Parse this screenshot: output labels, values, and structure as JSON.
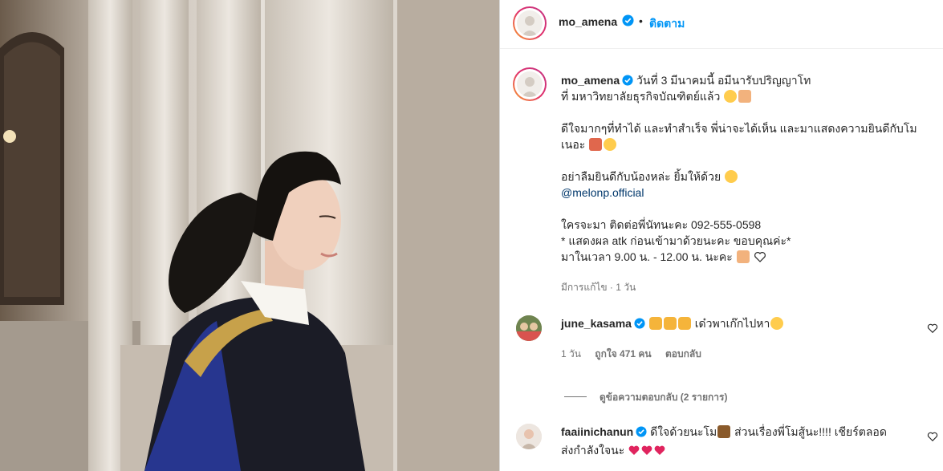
{
  "post": {
    "author": "mo_amena",
    "follow_label": "ติดตาม",
    "separator": "•"
  },
  "caption": {
    "author": "mo_amena",
    "line1": "วันที่ 3 มีนาคมนี้ อมีนารับปริญญาโท",
    "line2": "ที่ มหาวิทยาลัยธุรกิจบัณฑิตย์แล้ว",
    "line3": "ดีใจมากๆที่ทำได้ และทำสำเร็จ พี่น่าจะได้เห็น และมาแสดงความยินดีกับโม",
    "line4": "เนอะ",
    "line5": "อย่าลืมยินดีกับน้องหล่ะ ยิ้มให้ด้วย",
    "mention": "@melonp.official",
    "line6": "ใครจะมา ติดต่อพี่นัทนะคะ 092-555-0598",
    "line7": "* แสดงผล atk ก่อนเข้ามาด้วยนะคะ ขอบคุณค่ะ*",
    "line8": "มาในเวลา 9.00 น. - 12.00 น. นะคะ",
    "meta": "มีการแก้ไข · 1 วัน"
  },
  "comments": [
    {
      "user": "june_kasama",
      "text": "เด๋วพาเก๊กไปหา",
      "time": "1 วัน",
      "likes": "ถูกใจ 471 คน",
      "reply_label": "ตอบกลับ",
      "view_replies": "ดูข้อความตอบกลับ (2 รายการ)"
    },
    {
      "user": "faaiinichanun",
      "text_line1": "ดีใจด้วยนะโม",
      "text_line1b": "ส่วนเรื่องพี่โมสู้นะ!!!! เชียร์ตลอด",
      "text_line2": "ส่งกำลังใจนะ"
    }
  ],
  "colors": {
    "accent": "#0095f6",
    "mention": "#00376b",
    "verified": "#0095f6",
    "muted": "#737373"
  },
  "icons": [
    "verified-badge-icon",
    "heart-icon",
    "clap-emoji",
    "smile-emoji",
    "pray-emoji",
    "white-heart-emoji",
    "red-heart-emoji",
    "party-emoji"
  ]
}
